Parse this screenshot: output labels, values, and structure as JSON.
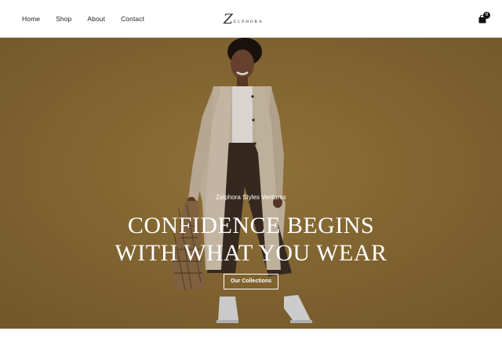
{
  "header": {
    "nav": [
      "Home",
      "Shop",
      "About",
      "Contact"
    ],
    "logo": {
      "initial": "Z",
      "rest": "ELPHORA"
    },
    "cart_count": "0"
  },
  "hero": {
    "subtitle": "Zelphora Styles Ventures",
    "headline_line1": "CONFIDENCE BEGINS",
    "headline_line2": "WITH WHAT YOU WEAR",
    "cta_label": "Our Collections"
  },
  "colors": {
    "hero_background": "#8c6d36",
    "text_dark": "#1d1d1d",
    "white": "#ffffff"
  },
  "icons": {
    "cart": "shopping-bag-icon"
  }
}
